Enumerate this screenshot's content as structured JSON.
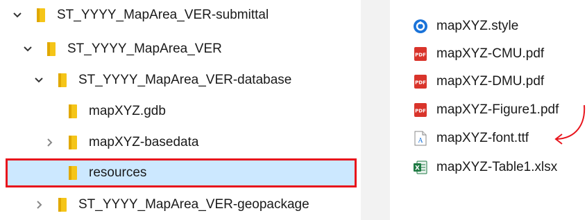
{
  "tree": {
    "items": [
      {
        "label": "ST_YYYY_MapArea_VER-submittal",
        "expander": "expanded"
      },
      {
        "label": "ST_YYYY_MapArea_VER",
        "expander": "expanded"
      },
      {
        "label": "ST_YYYY_MapArea_VER-database",
        "expander": "expanded"
      },
      {
        "label": "mapXYZ.gdb",
        "expander": "none"
      },
      {
        "label": "mapXYZ-basedata",
        "expander": "collapsed"
      },
      {
        "label": "resources",
        "expander": "none",
        "selected": true
      },
      {
        "label": "ST_YYYY_MapArea_VER-geopackage",
        "expander": "collapsed"
      }
    ]
  },
  "files": [
    {
      "name": "mapXYZ.style",
      "icon": "style-icon"
    },
    {
      "name": "mapXYZ-CMU.pdf",
      "icon": "pdf-icon"
    },
    {
      "name": "mapXYZ-DMU.pdf",
      "icon": "pdf-icon"
    },
    {
      "name": "mapXYZ-Figure1.pdf",
      "icon": "pdf-icon"
    },
    {
      "name": "mapXYZ-font.ttf",
      "icon": "font-file-icon"
    },
    {
      "name": "mapXYZ-Table1.xlsx",
      "icon": "excel-icon"
    }
  ],
  "colors": {
    "selection": "#cce8ff",
    "highlight_outline": "#e8141c",
    "arrow": "#e8141c",
    "folder": "#f5c518",
    "pdf": "#d9342b",
    "excel": "#1e7a43",
    "style": "#1a73d9"
  }
}
